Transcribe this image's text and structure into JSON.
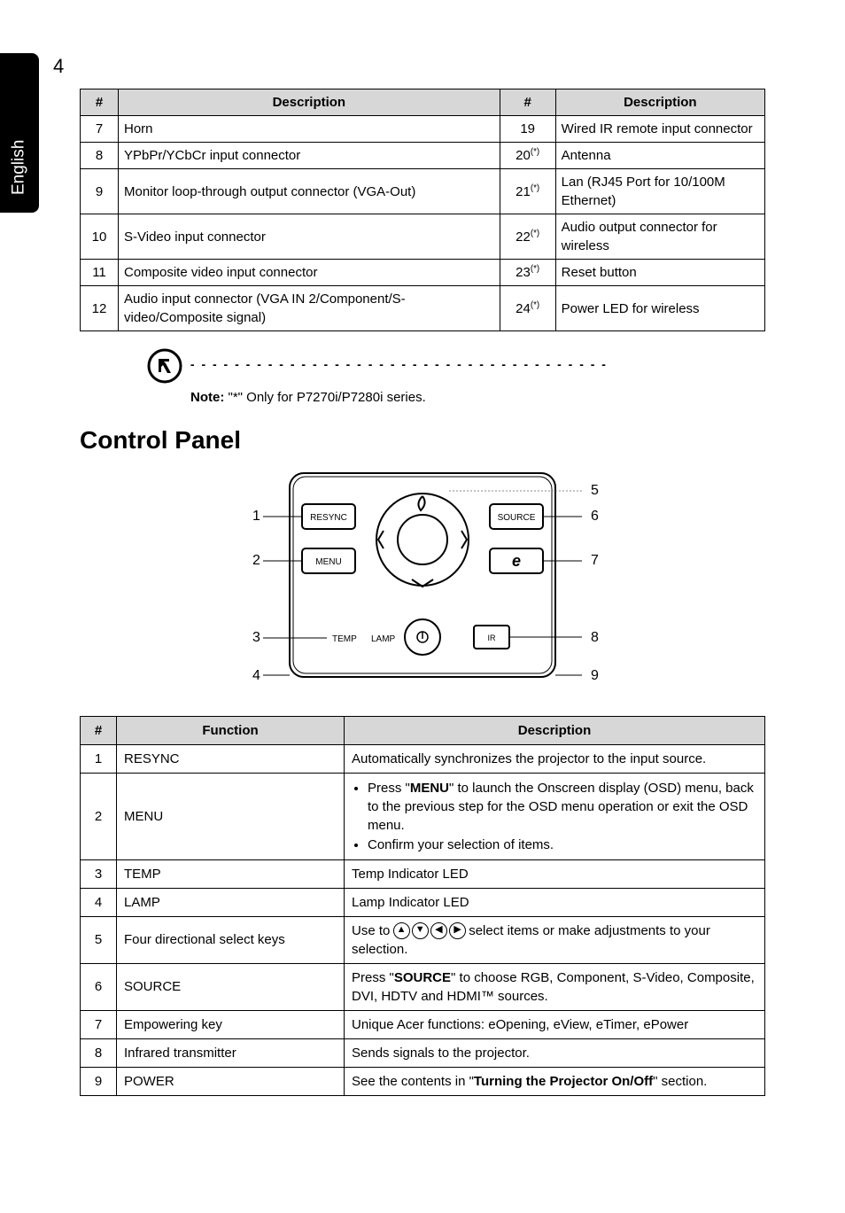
{
  "page": {
    "number": "4",
    "side_tab": "English"
  },
  "table1": {
    "head": {
      "h1": "#",
      "h2": "Description",
      "h3": "#",
      "h4": "Description"
    },
    "rows": [
      {
        "n1": "7",
        "d1": "Horn",
        "n2": "19",
        "d2": "Wired IR remote input connector"
      },
      {
        "n1": "8",
        "d1": "YPbPr/YCbCr input connector",
        "n2": "20",
        "n2s": "(*)",
        "d2": "Antenna"
      },
      {
        "n1": "9",
        "d1": "Monitor loop-through output connector (VGA-Out)",
        "n2": "21",
        "n2s": "(*)",
        "d2": "Lan (RJ45 Port for 10/100M Ethernet)"
      },
      {
        "n1": "10",
        "d1": "S-Video input connector",
        "n2": "22",
        "n2s": "(*)",
        "d2": "Audio output connector for wireless"
      },
      {
        "n1": "11",
        "d1": "Composite video input connector",
        "n2": "23",
        "n2s": "(*)",
        "d2": "Reset button"
      },
      {
        "n1": "12",
        "d1": "Audio input connector (VGA IN 2/Component/S-video/Composite signal)",
        "n2": "24",
        "n2s": "(*)",
        "d2": "Power LED for wireless"
      }
    ]
  },
  "note": {
    "label": "Note:",
    "text": " \"*\" Only for P7270i/P7280i series."
  },
  "section_title": "Control Panel",
  "diagram": {
    "labels": {
      "l1": "1",
      "l2": "2",
      "l3": "3",
      "l4": "4",
      "l5": "5",
      "l6": "6",
      "l7": "7",
      "l8": "8",
      "l9": "9",
      "resync": "RESYNC",
      "source": "SOURCE",
      "menu": "MENU",
      "temp": "TEMP",
      "lamp": "LAMP",
      "ir": "IR"
    }
  },
  "table2": {
    "head": {
      "h1": "#",
      "h2": "Function",
      "h3": "Description"
    },
    "rows": {
      "r1": {
        "n": "1",
        "fn": "RESYNC",
        "desc": "Automatically synchronizes the projector to the input source."
      },
      "r2": {
        "n": "2",
        "fn": "MENU",
        "b1a": "Press \"",
        "b1b": "MENU",
        "b1c": "\" to launch the Onscreen display (OSD) menu, back to the previous step for the OSD menu operation or exit the OSD menu.",
        "b2": "Confirm your selection of items."
      },
      "r3": {
        "n": "3",
        "fn": "TEMP",
        "desc": "Temp Indicator LED"
      },
      "r4": {
        "n": "4",
        "fn": "LAMP",
        "desc": "Lamp Indicator LED"
      },
      "r5": {
        "n": "5",
        "fn": "Four directional select keys",
        "d1": "Use to ",
        "d2": " select items or make adjustments to your selection."
      },
      "r6": {
        "n": "6",
        "fn": "SOURCE",
        "d1": "Press \"",
        "d1b": "SOURCE",
        "d1c": "\" to choose RGB, Component, S-Video, Composite, DVI, HDTV and HDMI™ sources."
      },
      "r7": {
        "n": "7",
        "fn": "Empowering key",
        "desc": "Unique Acer functions: eOpening, eView, eTimer, ePower"
      },
      "r8": {
        "n": "8",
        "fn": "Infrared transmitter",
        "desc": "Sends signals to the projector."
      },
      "r9": {
        "n": "9",
        "fn": "POWER",
        "d1": "See the contents in \"",
        "d1b": "Turning the Projector On/Off",
        "d1c": "\" section."
      }
    }
  }
}
